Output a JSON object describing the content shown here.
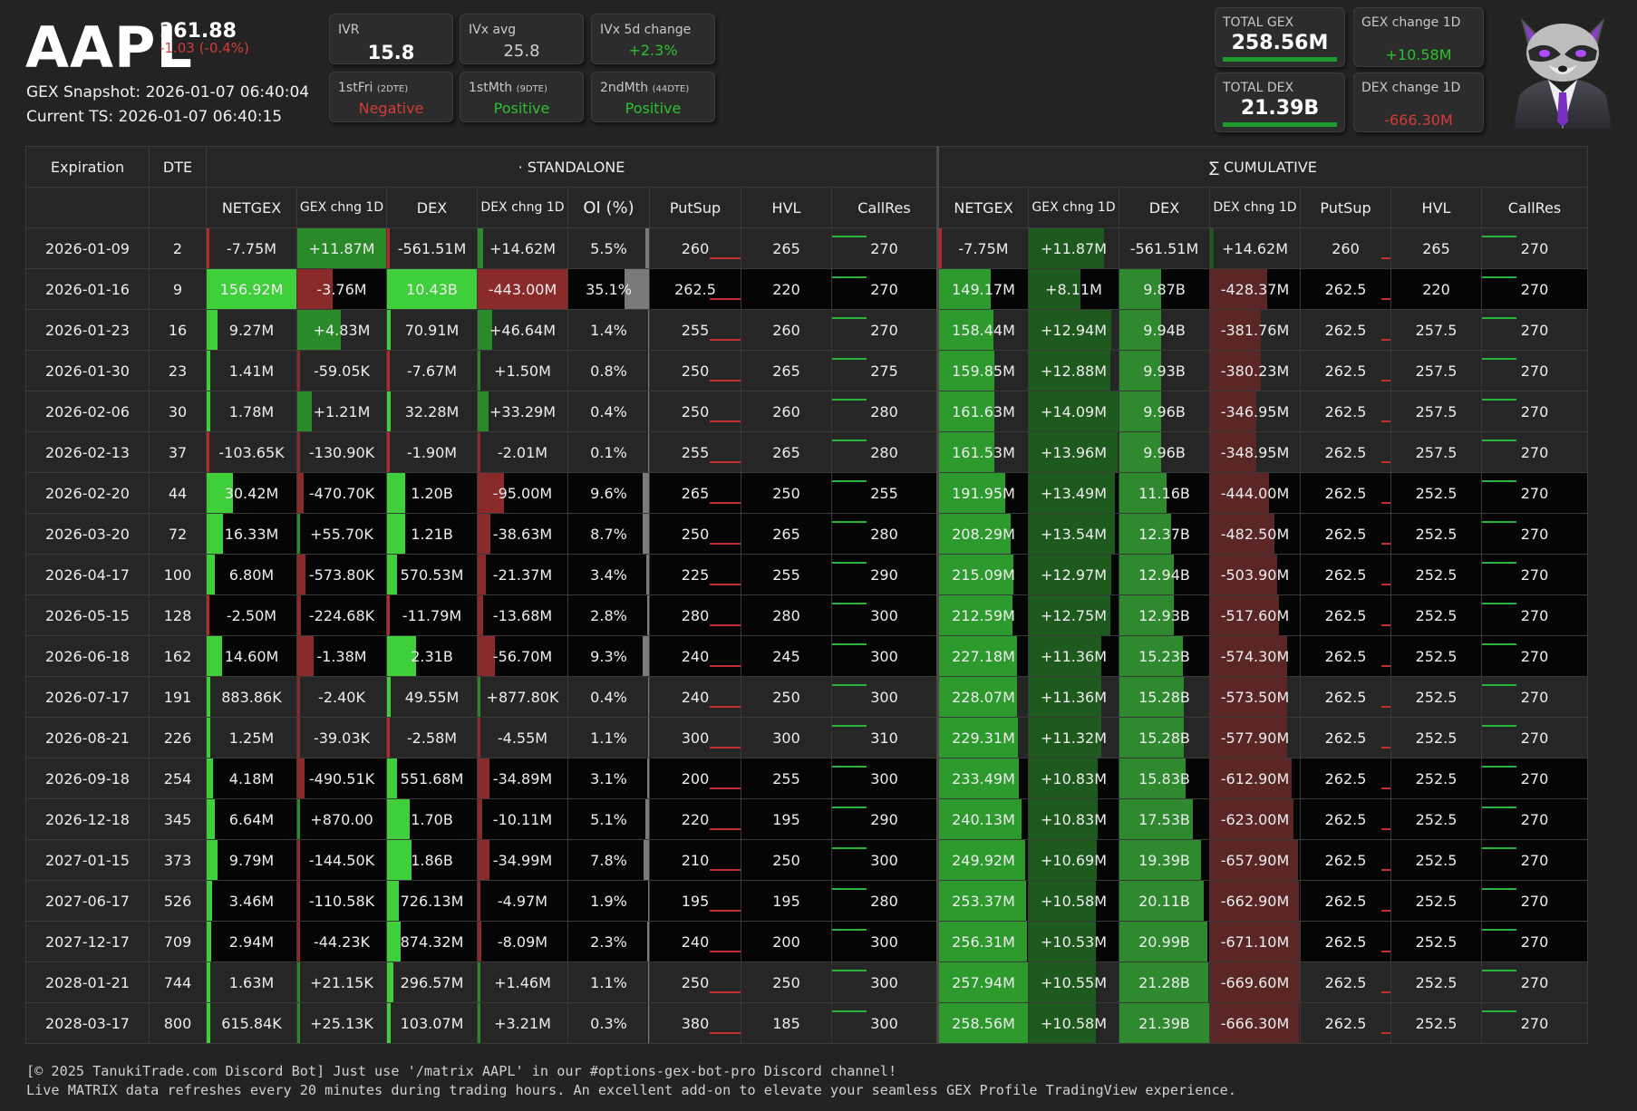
{
  "header": {
    "ticker": "AAPL",
    "price": "261.88",
    "price_change": "-1.03 (-0.4%)",
    "snapshot": "GEX Snapshot: 2026-01-07 06:40:04",
    "current_ts": "Current TS: 2026-01-07 06:40:15"
  },
  "stats": {
    "ivr": {
      "label": "IVR",
      "value": "15.8"
    },
    "ivx_avg": {
      "label": "IVx avg",
      "value": "25.8"
    },
    "ivx_5d": {
      "label": "IVx 5d change",
      "value": "+2.3%"
    },
    "first_fri": {
      "label": "1stFri",
      "dte": "(2DTE)",
      "value": "Negative"
    },
    "first_mth": {
      "label": "1stMth",
      "dte": "(9DTE)",
      "value": "Positive"
    },
    "second_mth": {
      "label": "2ndMth",
      "dte": "(44DTE)",
      "value": "Positive"
    }
  },
  "totals": {
    "total_gex": {
      "label": "TOTAL GEX",
      "value": "258.56M"
    },
    "gex_change": {
      "label": "GEX change 1D",
      "value": "+10.58M"
    },
    "total_dex": {
      "label": "TOTAL DEX",
      "value": "21.39B"
    },
    "dex_change": {
      "label": "DEX change 1D",
      "value": "-666.30M"
    }
  },
  "colors": {
    "positive": "#2dc02d",
    "negative": "#d43a3a",
    "background": "#232323",
    "cumulative_dex_negative": "#5a2626"
  },
  "mascot_icon": "raccoon-mascot-icon",
  "table": {
    "col_expiration": "Expiration",
    "col_dte": "DTE",
    "group_standalone": "· STANDALONE",
    "group_cumulative": "∑ CUMULATIVE",
    "sub_headers": [
      "NETGEX",
      "GEX chng 1D",
      "DEX",
      "DEX chng 1D",
      "OI (%)",
      "PutSup",
      "HVL",
      "CallRes"
    ],
    "cum_sub_headers": [
      "NETGEX",
      "GEX chng 1D",
      "DEX",
      "DEX chng 1D",
      "PutSup",
      "HVL",
      "CallRes"
    ],
    "rows": [
      {
        "exp": "2026-01-09",
        "dte": "2",
        "netgex": "-7.75M",
        "gex1d": "+11.87M",
        "dex": "-561.51M",
        "dex1d": "+14.62M",
        "oi": "5.5%",
        "putsup": "260",
        "hvl": "265",
        "callres": "270",
        "c_netgex": "-7.75M",
        "c_gex1d": "+11.87M",
        "c_dex": "-561.51M",
        "c_dex1d": "+14.62M",
        "c_putsup": "260",
        "c_hvl": "265",
        "c_callres": "270"
      },
      {
        "exp": "2026-01-16",
        "dte": "9",
        "netgex": "156.92M",
        "gex1d": "-3.76M",
        "dex": "10.43B",
        "dex1d": "-443.00M",
        "oi": "35.1%",
        "putsup": "262.5",
        "hvl": "220",
        "callres": "270",
        "c_netgex": "149.17M",
        "c_gex1d": "+8.11M",
        "c_dex": "9.87B",
        "c_dex1d": "-428.37M",
        "c_putsup": "262.5",
        "c_hvl": "220",
        "c_callres": "270"
      },
      {
        "exp": "2026-01-23",
        "dte": "16",
        "netgex": "9.27M",
        "gex1d": "+4.83M",
        "dex": "70.91M",
        "dex1d": "+46.64M",
        "oi": "1.4%",
        "putsup": "255",
        "hvl": "260",
        "callres": "270",
        "c_netgex": "158.44M",
        "c_gex1d": "+12.94M",
        "c_dex": "9.94B",
        "c_dex1d": "-381.76M",
        "c_putsup": "262.5",
        "c_hvl": "257.5",
        "c_callres": "270"
      },
      {
        "exp": "2026-01-30",
        "dte": "23",
        "netgex": "1.41M",
        "gex1d": "-59.05K",
        "dex": "-7.67M",
        "dex1d": "+1.50M",
        "oi": "0.8%",
        "putsup": "250",
        "hvl": "265",
        "callres": "275",
        "c_netgex": "159.85M",
        "c_gex1d": "+12.88M",
        "c_dex": "9.93B",
        "c_dex1d": "-380.23M",
        "c_putsup": "262.5",
        "c_hvl": "257.5",
        "c_callres": "270"
      },
      {
        "exp": "2026-02-06",
        "dte": "30",
        "netgex": "1.78M",
        "gex1d": "+1.21M",
        "dex": "32.28M",
        "dex1d": "+33.29M",
        "oi": "0.4%",
        "putsup": "250",
        "hvl": "260",
        "callres": "280",
        "c_netgex": "161.63M",
        "c_gex1d": "+14.09M",
        "c_dex": "9.96B",
        "c_dex1d": "-346.95M",
        "c_putsup": "262.5",
        "c_hvl": "257.5",
        "c_callres": "270"
      },
      {
        "exp": "2026-02-13",
        "dte": "37",
        "netgex": "-103.65K",
        "gex1d": "-130.90K",
        "dex": "-1.90M",
        "dex1d": "-2.01M",
        "oi": "0.1%",
        "putsup": "255",
        "hvl": "265",
        "callres": "280",
        "c_netgex": "161.53M",
        "c_gex1d": "+13.96M",
        "c_dex": "9.96B",
        "c_dex1d": "-348.95M",
        "c_putsup": "262.5",
        "c_hvl": "257.5",
        "c_callres": "270"
      },
      {
        "exp": "2026-02-20",
        "dte": "44",
        "netgex": "30.42M",
        "gex1d": "-470.70K",
        "dex": "1.20B",
        "dex1d": "-95.00M",
        "oi": "9.6%",
        "putsup": "265",
        "hvl": "250",
        "callres": "255",
        "c_netgex": "191.95M",
        "c_gex1d": "+13.49M",
        "c_dex": "11.16B",
        "c_dex1d": "-444.00M",
        "c_putsup": "262.5",
        "c_hvl": "252.5",
        "c_callres": "270"
      },
      {
        "exp": "2026-03-20",
        "dte": "72",
        "netgex": "16.33M",
        "gex1d": "+55.70K",
        "dex": "1.21B",
        "dex1d": "-38.63M",
        "oi": "8.7%",
        "putsup": "250",
        "hvl": "265",
        "callres": "280",
        "c_netgex": "208.29M",
        "c_gex1d": "+13.54M",
        "c_dex": "12.37B",
        "c_dex1d": "-482.50M",
        "c_putsup": "262.5",
        "c_hvl": "252.5",
        "c_callres": "270"
      },
      {
        "exp": "2026-04-17",
        "dte": "100",
        "netgex": "6.80M",
        "gex1d": "-573.80K",
        "dex": "570.53M",
        "dex1d": "-21.37M",
        "oi": "3.4%",
        "putsup": "225",
        "hvl": "255",
        "callres": "290",
        "c_netgex": "215.09M",
        "c_gex1d": "+12.97M",
        "c_dex": "12.94B",
        "c_dex1d": "-503.90M",
        "c_putsup": "262.5",
        "c_hvl": "252.5",
        "c_callres": "270"
      },
      {
        "exp": "2026-05-15",
        "dte": "128",
        "netgex": "-2.50M",
        "gex1d": "-224.68K",
        "dex": "-11.79M",
        "dex1d": "-13.68M",
        "oi": "2.8%",
        "putsup": "280",
        "hvl": "280",
        "callres": "300",
        "c_netgex": "212.59M",
        "c_gex1d": "+12.75M",
        "c_dex": "12.93B",
        "c_dex1d": "-517.60M",
        "c_putsup": "262.5",
        "c_hvl": "252.5",
        "c_callres": "270"
      },
      {
        "exp": "2026-06-18",
        "dte": "162",
        "netgex": "14.60M",
        "gex1d": "-1.38M",
        "dex": "2.31B",
        "dex1d": "-56.70M",
        "oi": "9.3%",
        "putsup": "240",
        "hvl": "245",
        "callres": "300",
        "c_netgex": "227.18M",
        "c_gex1d": "+11.36M",
        "c_dex": "15.23B",
        "c_dex1d": "-574.30M",
        "c_putsup": "262.5",
        "c_hvl": "252.5",
        "c_callres": "270"
      },
      {
        "exp": "2026-07-17",
        "dte": "191",
        "netgex": "883.86K",
        "gex1d": "-2.40K",
        "dex": "49.55M",
        "dex1d": "+877.80K",
        "oi": "0.4%",
        "putsup": "240",
        "hvl": "250",
        "callres": "300",
        "c_netgex": "228.07M",
        "c_gex1d": "+11.36M",
        "c_dex": "15.28B",
        "c_dex1d": "-573.50M",
        "c_putsup": "262.5",
        "c_hvl": "252.5",
        "c_callres": "270"
      },
      {
        "exp": "2026-08-21",
        "dte": "226",
        "netgex": "1.25M",
        "gex1d": "-39.03K",
        "dex": "-2.58M",
        "dex1d": "-4.55M",
        "oi": "1.1%",
        "putsup": "300",
        "hvl": "300",
        "callres": "310",
        "c_netgex": "229.31M",
        "c_gex1d": "+11.32M",
        "c_dex": "15.28B",
        "c_dex1d": "-577.90M",
        "c_putsup": "262.5",
        "c_hvl": "252.5",
        "c_callres": "270"
      },
      {
        "exp": "2026-09-18",
        "dte": "254",
        "netgex": "4.18M",
        "gex1d": "-490.51K",
        "dex": "551.68M",
        "dex1d": "-34.89M",
        "oi": "3.1%",
        "putsup": "200",
        "hvl": "255",
        "callres": "300",
        "c_netgex": "233.49M",
        "c_gex1d": "+10.83M",
        "c_dex": "15.83B",
        "c_dex1d": "-612.90M",
        "c_putsup": "262.5",
        "c_hvl": "252.5",
        "c_callres": "270"
      },
      {
        "exp": "2026-12-18",
        "dte": "345",
        "netgex": "6.64M",
        "gex1d": "+870.00",
        "dex": "1.70B",
        "dex1d": "-10.11M",
        "oi": "5.1%",
        "putsup": "220",
        "hvl": "195",
        "callres": "290",
        "c_netgex": "240.13M",
        "c_gex1d": "+10.83M",
        "c_dex": "17.53B",
        "c_dex1d": "-623.00M",
        "c_putsup": "262.5",
        "c_hvl": "252.5",
        "c_callres": "270"
      },
      {
        "exp": "2027-01-15",
        "dte": "373",
        "netgex": "9.79M",
        "gex1d": "-144.50K",
        "dex": "1.86B",
        "dex1d": "-34.99M",
        "oi": "7.8%",
        "putsup": "210",
        "hvl": "250",
        "callres": "300",
        "c_netgex": "249.92M",
        "c_gex1d": "+10.69M",
        "c_dex": "19.39B",
        "c_dex1d": "-657.90M",
        "c_putsup": "262.5",
        "c_hvl": "252.5",
        "c_callres": "270"
      },
      {
        "exp": "2027-06-17",
        "dte": "526",
        "netgex": "3.46M",
        "gex1d": "-110.58K",
        "dex": "726.13M",
        "dex1d": "-4.97M",
        "oi": "1.9%",
        "putsup": "195",
        "hvl": "195",
        "callres": "280",
        "c_netgex": "253.37M",
        "c_gex1d": "+10.58M",
        "c_dex": "20.11B",
        "c_dex1d": "-662.90M",
        "c_putsup": "262.5",
        "c_hvl": "252.5",
        "c_callres": "270"
      },
      {
        "exp": "2027-12-17",
        "dte": "709",
        "netgex": "2.94M",
        "gex1d": "-44.23K",
        "dex": "874.32M",
        "dex1d": "-8.09M",
        "oi": "2.3%",
        "putsup": "240",
        "hvl": "200",
        "callres": "300",
        "c_netgex": "256.31M",
        "c_gex1d": "+10.53M",
        "c_dex": "20.99B",
        "c_dex1d": "-671.10M",
        "c_putsup": "262.5",
        "c_hvl": "252.5",
        "c_callres": "270"
      },
      {
        "exp": "2028-01-21",
        "dte": "744",
        "netgex": "1.63M",
        "gex1d": "+21.15K",
        "dex": "296.57M",
        "dex1d": "+1.46M",
        "oi": "1.1%",
        "putsup": "250",
        "hvl": "250",
        "callres": "300",
        "c_netgex": "257.94M",
        "c_gex1d": "+10.55M",
        "c_dex": "21.28B",
        "c_dex1d": "-669.60M",
        "c_putsup": "262.5",
        "c_hvl": "252.5",
        "c_callres": "270"
      },
      {
        "exp": "2028-03-17",
        "dte": "800",
        "netgex": "615.84K",
        "gex1d": "+25.13K",
        "dex": "103.07M",
        "dex1d": "+3.21M",
        "oi": "0.3%",
        "putsup": "380",
        "hvl": "185",
        "callres": "300",
        "c_netgex": "258.56M",
        "c_gex1d": "+10.58M",
        "c_dex": "21.39B",
        "c_dex1d": "-666.30M",
        "c_putsup": "262.5",
        "c_hvl": "252.5",
        "c_callres": "270"
      }
    ]
  },
  "footer": {
    "line1": "[© 2025 TanukiTrade.com Discord Bot] Just use '/matrix AAPL' in our #options-gex-bot-pro Discord channel!",
    "line2": "Live MATRIX data refreshes every 20 minutes during trading hours. An excellent add-on to elevate your seamless GEX Profile TradingView experience."
  }
}
